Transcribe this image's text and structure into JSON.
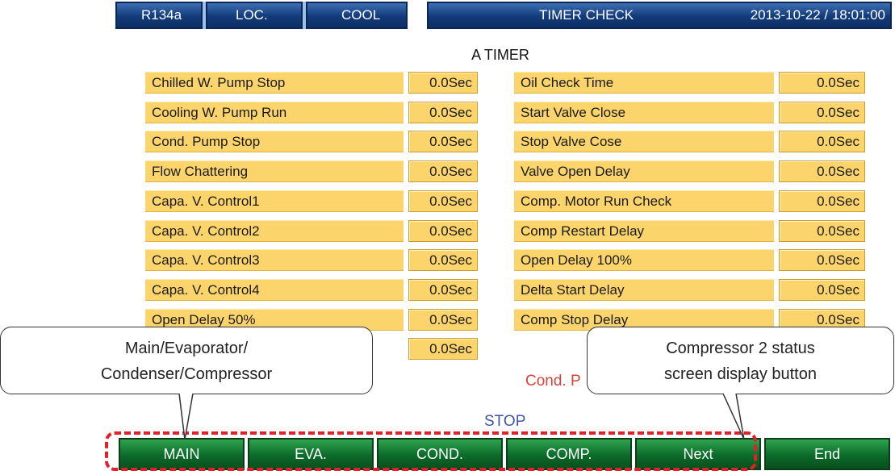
{
  "header": {
    "refrigerant": "R134a",
    "mode": "LOC.",
    "operation": "COOL",
    "screen_title": "TIMER CHECK",
    "datetime": "2013-10-22 / 18:01:00"
  },
  "page_title": "A TIMER",
  "timers_left": [
    {
      "label": "Chilled W. Pump Stop",
      "value": "0.0Sec"
    },
    {
      "label": "Cooling W. Pump Run",
      "value": "0.0Sec"
    },
    {
      "label": "Cond. Pump Stop",
      "value": "0.0Sec"
    },
    {
      "label": "Flow Chattering",
      "value": "0.0Sec"
    },
    {
      "label": "Capa. V. Control1",
      "value": "0.0Sec"
    },
    {
      "label": "Capa. V. Control2",
      "value": "0.0Sec"
    },
    {
      "label": "Capa. V. Control3",
      "value": "0.0Sec"
    },
    {
      "label": "Capa. V. Control4",
      "value": "0.0Sec"
    },
    {
      "label": "Open Delay 50%",
      "value": "0.0Sec"
    },
    {
      "label": "",
      "value": "0.0Sec"
    }
  ],
  "timers_right": [
    {
      "label": "Oil Check Time",
      "value": "0.0Sec"
    },
    {
      "label": "Start Valve Close",
      "value": "0.0Sec"
    },
    {
      "label": "Stop Valve Cose",
      "value": "0.0Sec"
    },
    {
      "label": "Valve Open Delay",
      "value": "0.0Sec"
    },
    {
      "label": "Comp. Motor Run Check",
      "value": "0.0Sec"
    },
    {
      "label": "Comp Restart Delay",
      "value": "0.0Sec"
    },
    {
      "label": "Open Delay 100%",
      "value": "0.0Sec"
    },
    {
      "label": "Delta Start Delay",
      "value": "0.0Sec"
    },
    {
      "label": "Comp Stop Delay",
      "value": "0.0Sec"
    }
  ],
  "status": {
    "cond_pump_partial": "Cond. P",
    "state": "STOP"
  },
  "buttons": {
    "main": "MAIN",
    "eva": "EVA.",
    "cond": "COND.",
    "comp": "COMP.",
    "next": "Next",
    "end": "End"
  },
  "callouts": {
    "left_line1": "Main/Evaporator/",
    "left_line2": "Condenser/Compressor",
    "right_line1": "Compressor 2 status",
    "right_line2": "screen display button"
  },
  "colors": {
    "header_blue": "#123a7a",
    "cell_yellow": "#fbd56b",
    "button_green": "#0c6b2a",
    "highlight_red": "#e2202a",
    "stop_text": "#3f55a8",
    "cond_text": "#d8433a"
  }
}
